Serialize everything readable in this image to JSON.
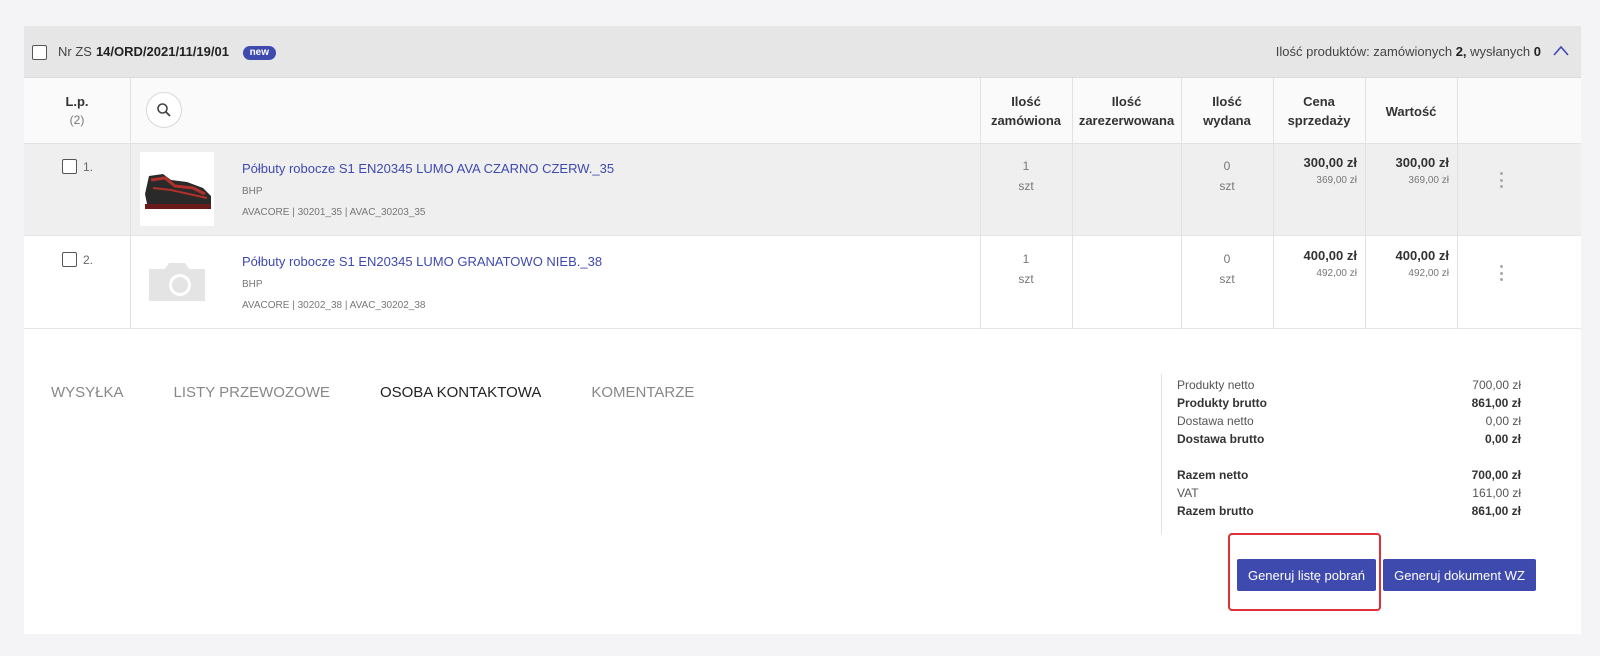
{
  "order": {
    "number_prefix": "Nr ZS",
    "number": "14/ORD/2021/11/19/01",
    "badge": "new",
    "summary_prefix": "Ilość produktów: zamówionych",
    "ordered_count": "2,",
    "summary_middle": "wysłanych",
    "sent_count": "0"
  },
  "table": {
    "headers": {
      "lp": "L.p.",
      "lp_count": "(2)",
      "ordered_1": "Ilość",
      "ordered_2": "zamówiona",
      "reserved_1": "Ilość",
      "reserved_2": "zarezerwowana",
      "issued_1": "Ilość",
      "issued_2": "wydana",
      "price_1": "Cena",
      "price_2": "sprzedaży",
      "value": "Wartość"
    },
    "rows": [
      {
        "lp": "1.",
        "name": "Półbuty robocze S1 EN20345 LUMO AVA CZARNO CZERW._35",
        "category": "BHP",
        "codes": "AVACORE | 30201_35 | AVAC_30203_35",
        "ordered_qty": "1",
        "ordered_unit": "szt",
        "issued_qty": "0",
        "issued_unit": "szt",
        "price_net": "300,00 zł",
        "price_gross": "369,00 zł",
        "value_net": "300,00 zł",
        "value_gross": "369,00 zł",
        "thumb": "shoe-image"
      },
      {
        "lp": "2.",
        "name": "Półbuty robocze S1 EN20345 LUMO GRANATOWO NIEB._38",
        "category": "BHP",
        "codes": "AVACORE | 30202_38 | AVAC_30202_38",
        "ordered_qty": "1",
        "ordered_unit": "szt",
        "issued_qty": "0",
        "issued_unit": "szt",
        "price_net": "400,00 zł",
        "price_gross": "492,00 zł",
        "value_net": "400,00 zł",
        "value_gross": "492,00 zł",
        "thumb": "camera-placeholder-icon"
      }
    ]
  },
  "tabs": [
    "WYSYŁKA",
    "LISTY PRZEWOZOWE",
    "OSOBA KONTAKTOWA",
    "KOMENTARZE"
  ],
  "totals": {
    "products_net_label": "Produkty netto",
    "products_net": "700,00 zł",
    "products_gross_label": "Produkty brutto",
    "products_gross": "861,00 zł",
    "delivery_net_label": "Dostawa netto",
    "delivery_net": "0,00 zł",
    "delivery_gross_label": "Dostawa brutto",
    "delivery_gross": "0,00 zł",
    "total_net_label": "Razem netto",
    "total_net": "700,00 zł",
    "vat_label": "VAT",
    "vat": "161,00 zł",
    "total_gross_label": "Razem brutto",
    "total_gross": "861,00 zł"
  },
  "buttons": {
    "pick_list": "Generuj listę pobrań",
    "wz_document": "Generuj dokument WZ"
  },
  "colors": {
    "accent": "#3f4aae",
    "highlight": "#e0303a",
    "header_bg": "#e6e6e6"
  }
}
